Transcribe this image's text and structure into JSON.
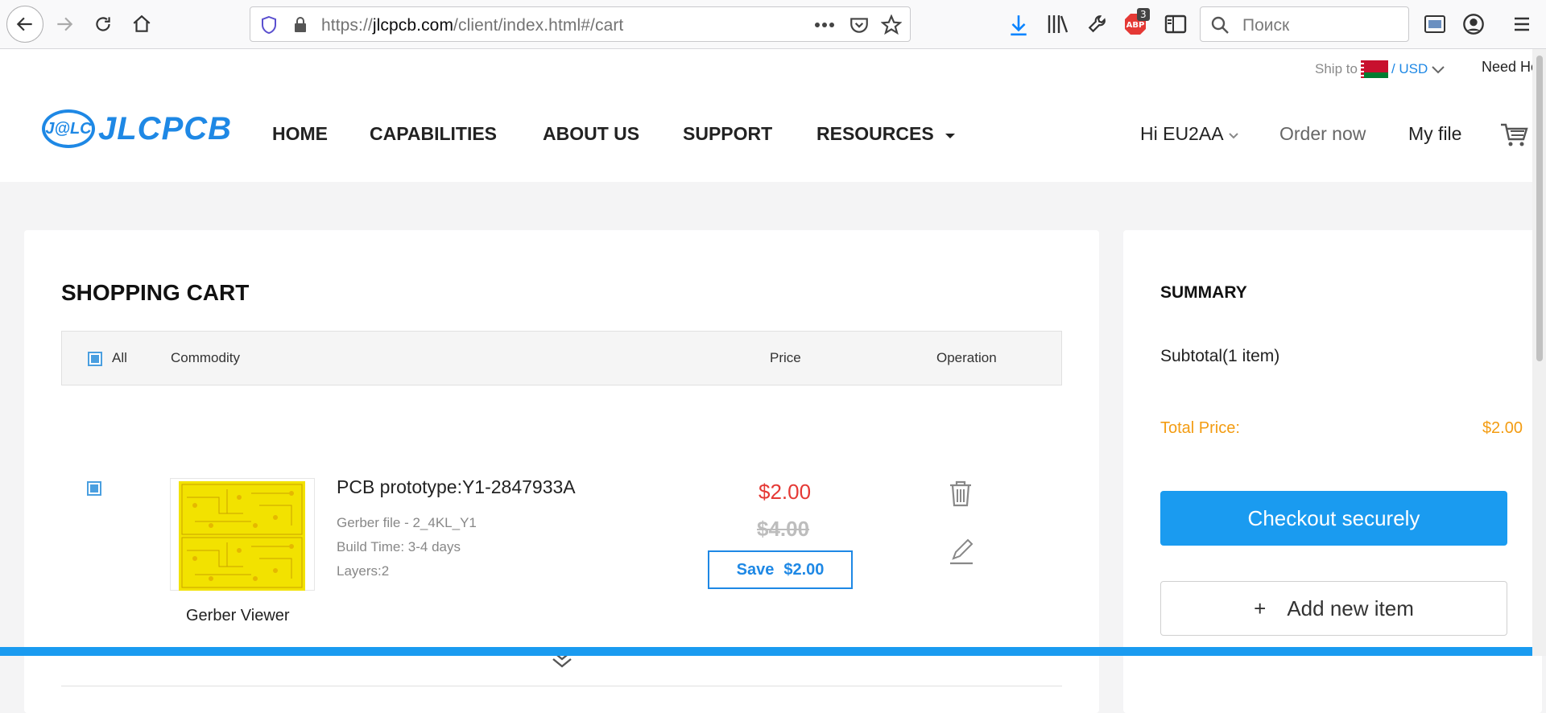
{
  "browser": {
    "url_prefix": "https://",
    "url_host": "jlcpcb.com",
    "url_path": "/client/index.html#/cart",
    "search_placeholder": "Поиск",
    "adblock_badge": "3"
  },
  "header": {
    "ship_to_label": "Ship to",
    "currency": "/ USD",
    "need_help": "Need He",
    "logo_mark": "J@LC",
    "logo_text": "JLCPCB",
    "nav": [
      "HOME",
      "CAPABILITIES",
      "ABOUT US",
      "SUPPORT",
      "RESOURCES"
    ],
    "greeting": "Hi EU2AA",
    "order_now": "Order now",
    "my_file": "My file"
  },
  "cart": {
    "title": "SHOPPING CART",
    "columns": {
      "all": "All",
      "commodity": "Commodity",
      "price": "Price",
      "operation": "Operation"
    },
    "item": {
      "title": "PCB prototype:Y1-2847933A",
      "gerber_file": "Gerber file - 2_4KL_Y1",
      "build_time": "Build Time: 3-4 days",
      "layers": "Layers:2",
      "viewer_label": "Gerber Viewer",
      "price_now": "$2.00",
      "price_old": "$4.00",
      "save_label": "Save",
      "save_amount": "$2.00"
    }
  },
  "summary": {
    "title": "SUMMARY",
    "subtotal": "Subtotal(1 item)",
    "total_label": "Total Price:",
    "total_value": "$2.00",
    "checkout": "Checkout securely",
    "add_new_plus": "+",
    "add_new": "Add new item"
  },
  "colors": {
    "accent": "#1a9bf0",
    "price_red": "#e53935",
    "total_orange": "#f39c12"
  }
}
